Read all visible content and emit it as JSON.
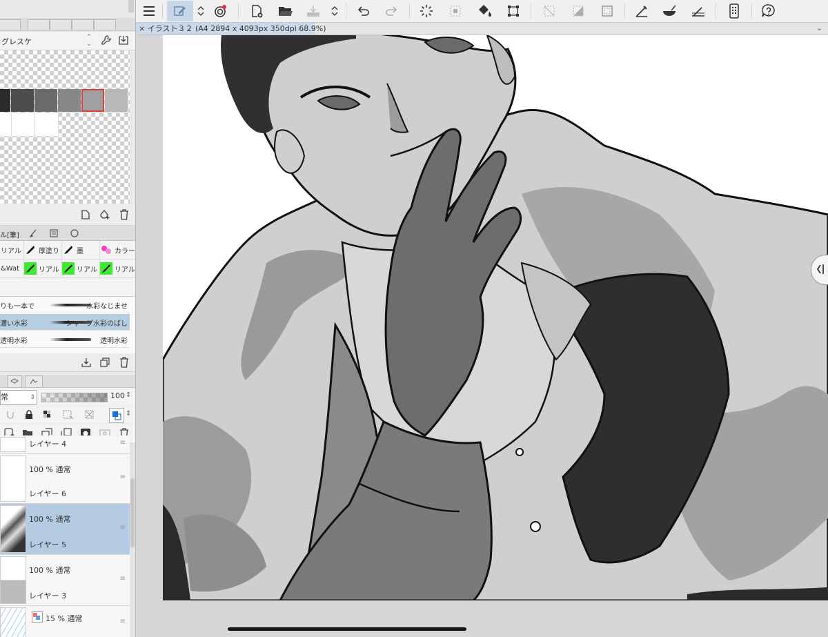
{
  "palette": {
    "name": "グレスケ",
    "colors": {
      "row1": [
        "#2b2b2b",
        "#4d4d4d",
        "#6a6a6a",
        "#878787",
        "#a0a0a0",
        "#b8b8b8"
      ],
      "row2": [
        "#ffffff",
        "#ffffff",
        "#ffffff"
      ],
      "selected": 4,
      "selected_border": "#d94040"
    }
  },
  "tool_palette": {
    "tab_label": "ル[筆]",
    "tools": [
      {
        "label": "リアル",
        "icon": "brush-icon",
        "color": "#f3f3f3"
      },
      {
        "label": "厚塗り",
        "icon": "oil-brush-icon",
        "color": "#f3f3f3"
      },
      {
        "label": "墨",
        "icon": "ink-brush-icon",
        "color": "#f3f3f3"
      },
      {
        "label": "カラー",
        "icon": "color-dots-icon",
        "color": "#f3f3f3"
      },
      {
        "label": "&Wat",
        "icon": "",
        "color": "#f3f3f3"
      },
      {
        "label": "リアル",
        "icon": "pen-green-icon",
        "color": "#3dea2f"
      },
      {
        "label": "リアル",
        "icon": "pen-green-icon",
        "color": "#3dea2f"
      },
      {
        "label": "リアル",
        "icon": "pen-green-icon",
        "color": "#3dea2f"
      }
    ]
  },
  "brushes": [
    {
      "left": "りも一本で",
      "right": "水彩なじませ",
      "selected": false
    },
    {
      "left": "濃い水彩",
      "right": "シャープ水彩のばし",
      "selected": true
    },
    {
      "left": "透明水彩",
      "right": "透明水彩",
      "selected": false
    }
  ],
  "layer_panel": {
    "blend_mode": "常",
    "opacity": "100",
    "opacity_fraction": 1.0,
    "layers": [
      {
        "info": "",
        "name": "レイヤー 4",
        "selected": false
      },
      {
        "info": "100 % 通常",
        "name": "レイヤー 6",
        "selected": false
      },
      {
        "info": "100 % 通常",
        "name": "レイヤー 5",
        "selected": true
      },
      {
        "info": "100 % 通常",
        "name": "レイヤー 3",
        "selected": false
      },
      {
        "info": "15 % 通常",
        "name": "",
        "selected": false
      }
    ]
  },
  "document": {
    "tab_title": "× イラスト３２ (A4 2894 x 4093px 350dpi 68.9%)"
  },
  "toolbar": {
    "icons": [
      "menu-icon",
      "edit-layer-icon",
      "stepper-icon",
      "autosave-icon",
      "new-canvas-icon",
      "open-folder-icon",
      "save-icon",
      "stepper-icon",
      "undo-icon",
      "redo-icon",
      "loading-icon",
      "selection-icon",
      "fill-icon",
      "transform-icon",
      "clear-selection-icon",
      "invert-selection-icon",
      "border-selection-icon",
      "ruler-icon",
      "fill-tool-icon",
      "horizon-icon",
      "companion-icon",
      "help-icon"
    ]
  }
}
